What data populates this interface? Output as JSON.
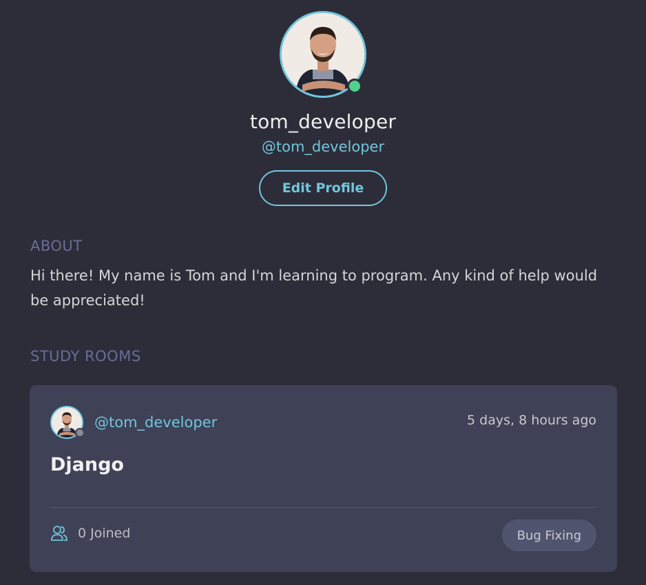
{
  "profile": {
    "display_name": "tom_developer",
    "handle": "@tom_developer",
    "edit_label": "Edit Profile",
    "status": "online",
    "avatar_icon": "user-avatar-photo"
  },
  "about": {
    "title": "ABOUT",
    "text": "Hi there! My name is Tom and I'm learning to program. Any kind of help would be appreciated!"
  },
  "study_rooms": {
    "title": "STUDY ROOMS",
    "rooms": [
      {
        "host": "@tom_developer",
        "host_status": "offline",
        "time": "5 days, 8 hours ago",
        "name": "Django",
        "joined": "0 Joined",
        "topic": "Bug Fixing"
      }
    ]
  },
  "colors": {
    "background": "#2d2d39",
    "accent": "#71c6dd",
    "card": "#3f4156",
    "section_title": "#696d97",
    "online": "#4fd18b"
  }
}
